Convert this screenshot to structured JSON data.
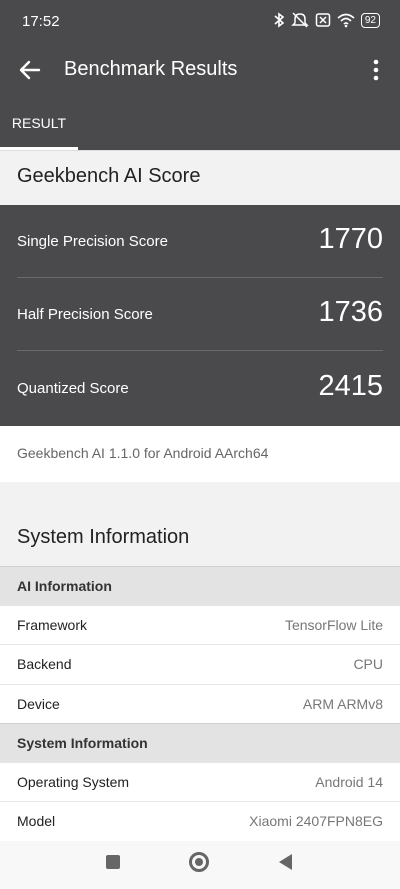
{
  "status": {
    "time": "17:52",
    "battery": "92"
  },
  "appbar": {
    "title": "Benchmark Results"
  },
  "tabs": [
    {
      "label": "RESULT"
    }
  ],
  "ai_score": {
    "heading": "Geekbench AI Score",
    "rows": [
      {
        "label": "Single Precision Score",
        "value": "1770"
      },
      {
        "label": "Half Precision Score",
        "value": "1736"
      },
      {
        "label": "Quantized Score",
        "value": "2415"
      }
    ],
    "version": "Geekbench AI 1.1.0 for Android AArch64"
  },
  "system": {
    "heading": "System Information",
    "ai_section": "AI Information",
    "ai_rows": [
      {
        "k": "Framework",
        "v": "TensorFlow Lite"
      },
      {
        "k": "Backend",
        "v": "CPU"
      },
      {
        "k": "Device",
        "v": "ARM ARMv8"
      }
    ],
    "sys_section": "System Information",
    "sys_rows": [
      {
        "k": "Operating System",
        "v": "Android 14"
      },
      {
        "k": "Model",
        "v": "Xiaomi 2407FPN8EG"
      }
    ]
  }
}
